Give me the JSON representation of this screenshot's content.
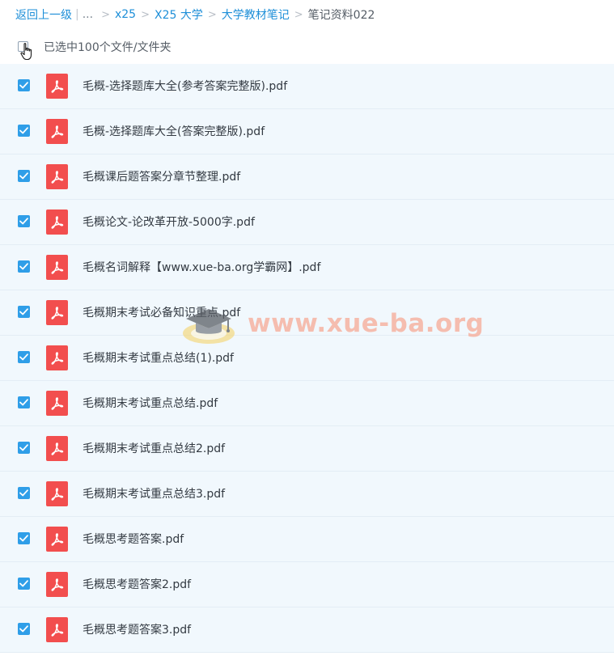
{
  "breadcrumb": {
    "back_label": "返回上一级",
    "pipe": "|",
    "ellipsis": "...",
    "separator": ">",
    "items": [
      "x25",
      "X25 大学",
      "大学教材笔记"
    ],
    "current": "笔记资料022"
  },
  "selection": {
    "count_label": "已选中100个文件/文件夹"
  },
  "files": [
    {
      "name": "毛概-选择题库大全(参考答案完整版).pdf",
      "checked": true,
      "icon": "pdf-icon"
    },
    {
      "name": "毛概-选择题库大全(答案完整版).pdf",
      "checked": true,
      "icon": "pdf-icon"
    },
    {
      "name": "毛概课后题答案分章节整理.pdf",
      "checked": true,
      "icon": "pdf-icon"
    },
    {
      "name": "毛概论文-论改革开放-5000字.pdf",
      "checked": true,
      "icon": "pdf-icon"
    },
    {
      "name": "毛概名词解释【www.xue-ba.org学霸网】.pdf",
      "checked": true,
      "icon": "pdf-icon"
    },
    {
      "name": "毛概期末考试必备知识重点.pdf",
      "checked": true,
      "icon": "pdf-icon"
    },
    {
      "name": "毛概期末考试重点总结(1).pdf",
      "checked": true,
      "icon": "pdf-icon"
    },
    {
      "name": "毛概期末考试重点总结.pdf",
      "checked": true,
      "icon": "pdf-icon"
    },
    {
      "name": "毛概期末考试重点总结2.pdf",
      "checked": true,
      "icon": "pdf-icon"
    },
    {
      "name": "毛概期末考试重点总结3.pdf",
      "checked": true,
      "icon": "pdf-icon"
    },
    {
      "name": "毛概思考题答案.pdf",
      "checked": true,
      "icon": "pdf-icon"
    },
    {
      "name": "毛概思考题答案2.pdf",
      "checked": true,
      "icon": "pdf-icon"
    },
    {
      "name": "毛概思考题答案3.pdf",
      "checked": true,
      "icon": "pdf-icon"
    }
  ],
  "watermark": {
    "text": "www.xue-ba.org"
  },
  "colors": {
    "link": "#1e8fd8",
    "checkbox": "#2f9ee8",
    "pdf": "#f24e4e",
    "row_background": "#f1f8fd"
  }
}
